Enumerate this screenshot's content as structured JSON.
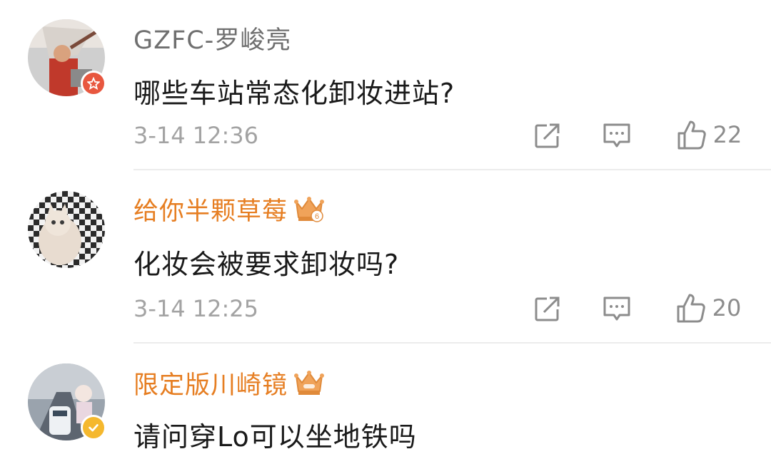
{
  "comments": [
    {
      "username": "GZFC-罗峻亮",
      "text": "哪些车站常态化卸妆进站?",
      "time": "3-14 12:36",
      "likes": "22",
      "name_color": "#6f6f6f",
      "badge": "red-star-verified-icon",
      "member_crown": false
    },
    {
      "username": "给你半颗草莓",
      "text": "化妆会被要求卸妆吗?",
      "time": "3-14 12:25",
      "likes": "20",
      "name_color": "#e67e22",
      "badge": null,
      "member_crown": true,
      "crown_level": "6"
    },
    {
      "username": "限定版川崎镜",
      "text": "请问穿Lo可以坐地铁吗",
      "name_color": "#e67e22",
      "badge": "yellow-verified-icon",
      "member_crown": true
    }
  ],
  "colors": {
    "orange_name": "#e67e22",
    "gray_name": "#6f6f6f",
    "time_gray": "#a3a3a3",
    "icon_gray": "#8c8c8c"
  }
}
